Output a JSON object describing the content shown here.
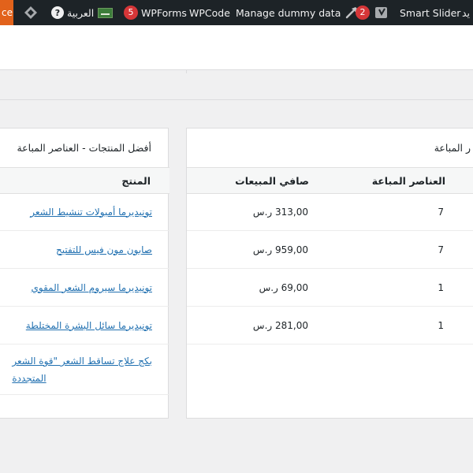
{
  "adminbar": {
    "cut_left": "ce",
    "language": "العربية",
    "wpforms_count": "5",
    "wpforms": "WPForms",
    "wpcode": "WPCode",
    "dummy": "Manage dummy data",
    "updates_count": "2",
    "smart_slider": "Smart Slider",
    "cut_right": "يد"
  },
  "sales_card": {
    "title": "ر المباعة",
    "columns": [
      "العناصر المباعة",
      "صافي المبيعات"
    ],
    "rows": [
      {
        "items": "7",
        "net": "313,00 ر.س"
      },
      {
        "items": "7",
        "net": "959,00 ر.س"
      },
      {
        "items": "1",
        "net": "69,00 ر.س"
      },
      {
        "items": "1",
        "net": "281,00 ر.س"
      }
    ]
  },
  "top_products": {
    "title": "أفضل المنتجات - العناصر المباعة",
    "column": "المنتج",
    "rows": [
      "تونيديرما أمبولات تنشيط الشعر",
      "صابون مون فيس للتفتيح",
      "تونيديرما سيروم الشعر المقوي",
      "تونيديرما سائل البشرة المختلطة",
      "بكج علاج تساقط الشعر \"قوة الشعر",
      "المتجددة"
    ]
  }
}
